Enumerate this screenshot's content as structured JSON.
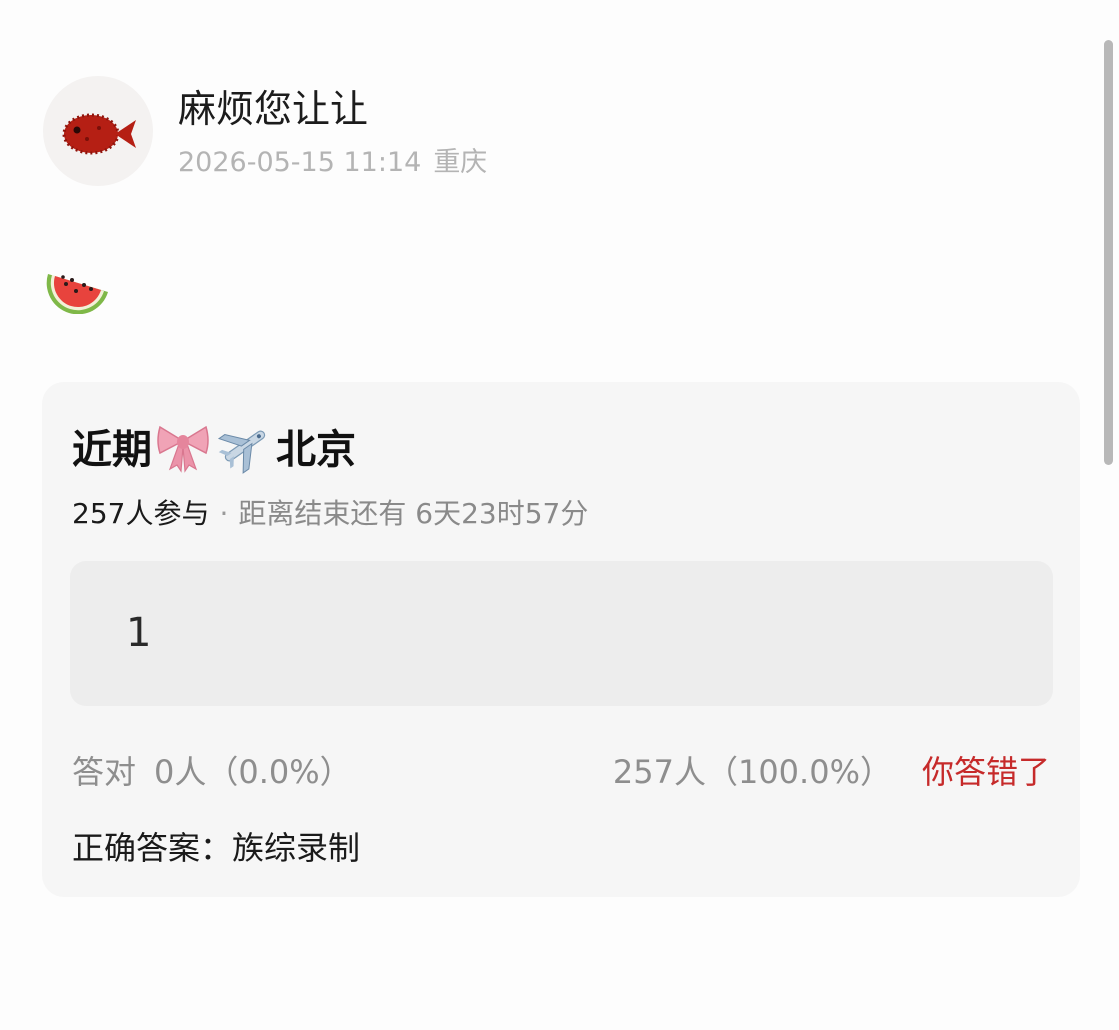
{
  "post": {
    "author": "麻烦您让让",
    "date": "2026-05-15 11:14",
    "location": "重庆",
    "avatar_icon": "red-fish-icon",
    "content_emoji": "watermelon-icon"
  },
  "poll": {
    "title_prefix": "近期",
    "title_icons": [
      "ribbon-bow-icon",
      "airplane-icon"
    ],
    "title_suffix": "北京",
    "participants": "257人参与",
    "separator": "·",
    "deadline": "距离结束还有 6天23时57分",
    "answer_text": "1",
    "correct_label": "答对",
    "correct_stats": "0人（0.0%）",
    "wrong_stats": "257人（100.0%）",
    "verdict": "你答错了",
    "correct_answer_label": "正确答案：族综录制",
    "colors": {
      "verdict": "#c62a2a",
      "card_bg": "#f6f6f6",
      "answer_bg": "#ededed"
    }
  }
}
